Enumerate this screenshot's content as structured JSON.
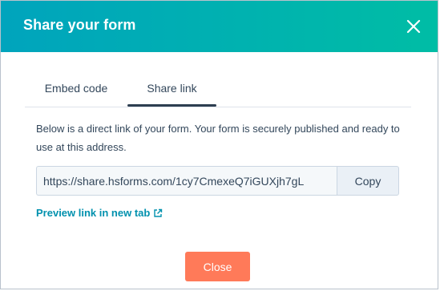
{
  "dialog": {
    "title": "Share your form",
    "close_icon": "close-icon"
  },
  "tabs": [
    {
      "label": "Embed code",
      "active": false
    },
    {
      "label": "Share link",
      "active": true
    }
  ],
  "description": "Below is a direct link of your form. Your form is securely published and ready to use at this address.",
  "share_link": {
    "url": "https://share.hsforms.com/1cy7CmexeQ7iGUXjh7gL",
    "copy_label": "Copy"
  },
  "preview": {
    "label": "Preview link in new tab",
    "icon": "external-link-icon"
  },
  "footer": {
    "close_label": "Close"
  },
  "colors": {
    "header_gradient_start": "#00a4bd",
    "header_gradient_end": "#00bda5",
    "link": "#0091ae",
    "primary_button": "#ff7a59",
    "text": "#33475b"
  }
}
